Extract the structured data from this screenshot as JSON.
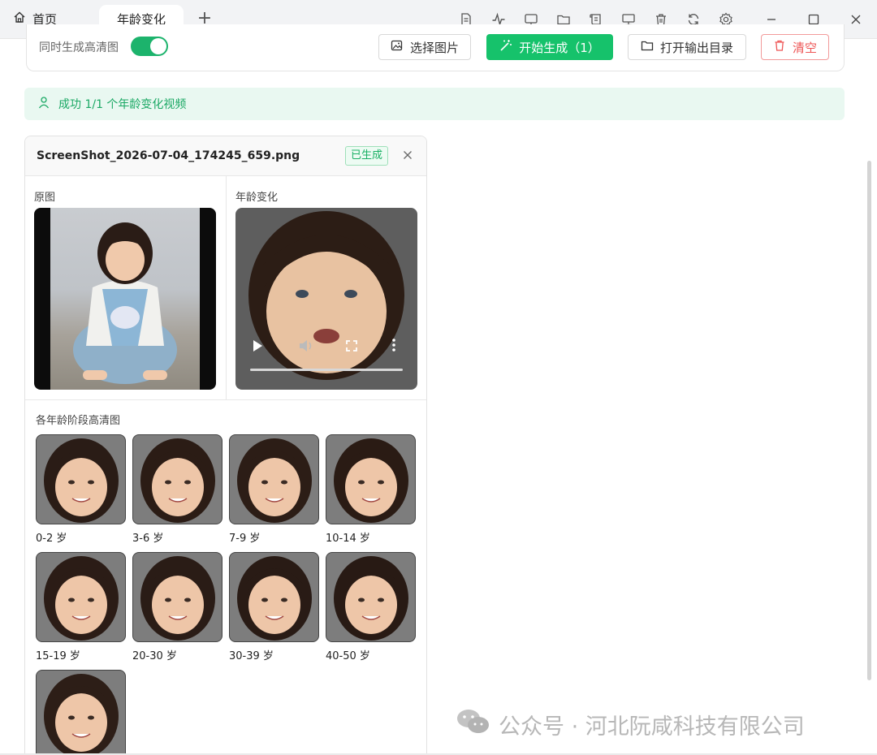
{
  "titlebar": {
    "home_label": "首页",
    "active_tab_label": "年龄变化",
    "add_tab_label": "+",
    "toolbar_icons": [
      "document-icon",
      "activity-icon",
      "slides-icon",
      "folder-icon",
      "scroll-icon",
      "monitor-icon",
      "trash-icon",
      "refresh-icon",
      "settings-icon"
    ]
  },
  "options": {
    "hd_label": "同时生成高清图",
    "hd_enabled": true,
    "select_image_label": "选择图片",
    "start_generate_label": "开始生成（1）",
    "open_output_label": "打开输出目录",
    "clear_label": "清空"
  },
  "alert": {
    "text": "成功 1/1 个年龄变化视频"
  },
  "result": {
    "filename": "ScreenShot_2026-07-04_174245_659.png",
    "status": "已生成",
    "original_label": "原图",
    "age_change_label": "年龄变化",
    "stages_label": "各年龄阶段高清图",
    "stages": [
      {
        "label": "0-2 岁"
      },
      {
        "label": "3-6 岁"
      },
      {
        "label": "7-9 岁"
      },
      {
        "label": "10-14 岁"
      },
      {
        "label": "15-19 岁"
      },
      {
        "label": "20-30 岁"
      },
      {
        "label": "30-39 岁"
      },
      {
        "label": "40-50 岁"
      },
      {
        "label": ""
      }
    ]
  },
  "watermark": {
    "text": "公众号 · 河北阮咸科技有限公司"
  },
  "colors": {
    "accent": "#16c26b",
    "danger": "#ee5555",
    "alert_bg": "#e9f8f1"
  }
}
